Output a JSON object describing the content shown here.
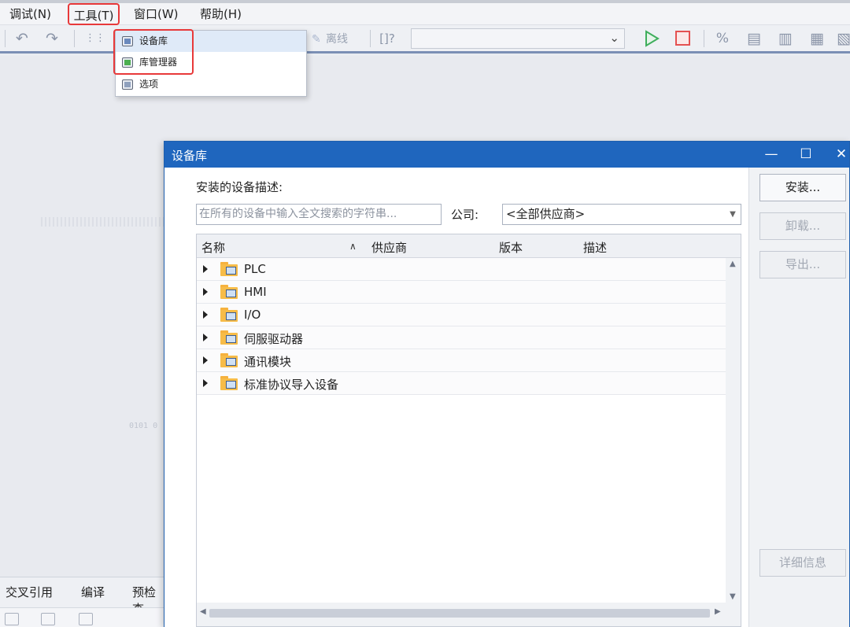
{
  "menubar": {
    "items": [
      "调试(N)",
      "工具(T)",
      "窗口(W)",
      "帮助(H)"
    ]
  },
  "toolbar": {
    "offline_label": "离线",
    "icons": [
      "undo-icon",
      "redo-icon",
      "build-icon",
      "offline-icon",
      "help-icon",
      "run-icon",
      "stop-icon",
      "tool-icon-1",
      "tool-icon-2",
      "tool-icon-3",
      "tool-icon-4",
      "tool-icon-5"
    ]
  },
  "tools_menu": {
    "items": [
      "设备库",
      "库管理器",
      "选项"
    ]
  },
  "bottom_panel": {
    "tabs": [
      "交叉引用",
      "编译",
      "预检查"
    ]
  },
  "workspace": {
    "deco_text": "0101 0"
  },
  "dialog": {
    "title": "设备库",
    "window_buttons": {
      "minimize": "—",
      "maximize": "☐",
      "close": "✕"
    },
    "description_label": "安装的设备描述:",
    "search_placeholder": "在所有的设备中输入全文搜索的字符串...",
    "company_label": "公司:",
    "company_value": "<全部供应商>",
    "columns": [
      "名称",
      "供应商",
      "版本",
      "描述"
    ],
    "rows": [
      {
        "name": "PLC"
      },
      {
        "name": "HMI"
      },
      {
        "name": "I/O"
      },
      {
        "name": "伺服驱动器"
      },
      {
        "name": "通讯模块"
      },
      {
        "name": "标准协议导入设备"
      }
    ],
    "buttons": {
      "install": "安装...",
      "uninstall": "卸载...",
      "export": "导出...",
      "details": "详细信息"
    }
  },
  "colors": {
    "titlebar": "#1f66be",
    "highlight_box": "#e8393a",
    "folder": "#f7bc48"
  }
}
